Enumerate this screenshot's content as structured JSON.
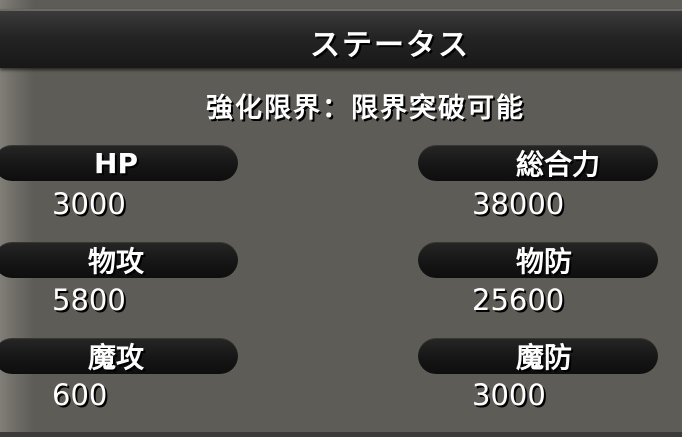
{
  "title": "ステータス",
  "limit_text": "強化限界：限界突破可能",
  "stats": {
    "hp": {
      "label": "HP",
      "value": "3000"
    },
    "total_power": {
      "label": "総合力",
      "value": "38000"
    },
    "physical_attack": {
      "label": "物攻",
      "value": "5800"
    },
    "physical_defense": {
      "label": "物防",
      "value": "25600"
    },
    "magic_attack": {
      "label": "魔攻",
      "value": "600"
    },
    "magic_defense": {
      "label": "魔防",
      "value": "3000"
    }
  }
}
